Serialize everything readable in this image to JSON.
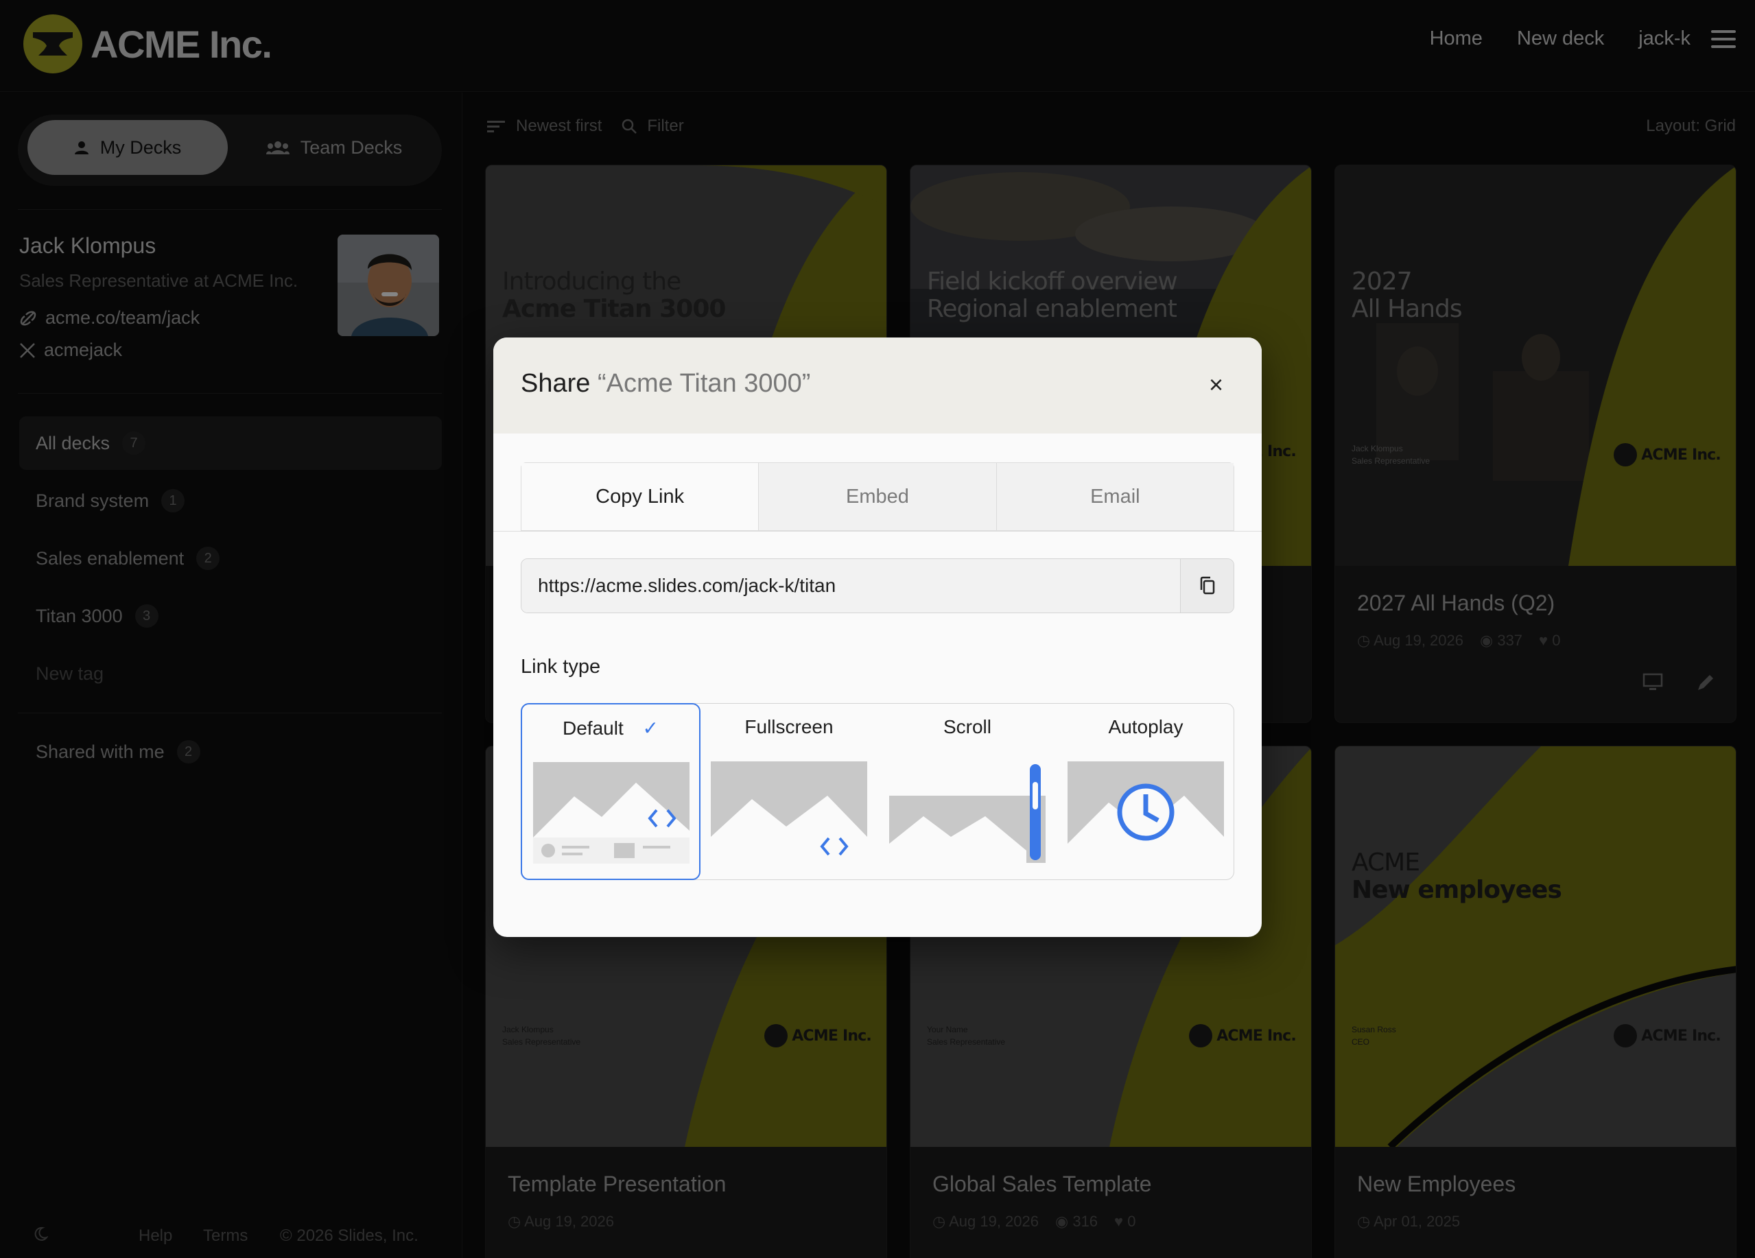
{
  "header": {
    "brand": "ACME Inc.",
    "nav": [
      "Home",
      "New deck",
      "jack-k"
    ]
  },
  "sidebar": {
    "tabs": {
      "my": "My Decks",
      "team": "Team Decks"
    },
    "profile": {
      "name": "Jack Klompus",
      "role": "Sales Representative at ACME Inc.",
      "website": "acme.co/team/jack",
      "x_handle": "acmejack"
    },
    "tags": [
      {
        "label": "All decks",
        "count": "7"
      },
      {
        "label": "Brand system",
        "count": "1"
      },
      {
        "label": "Sales enablement",
        "count": "2"
      },
      {
        "label": "Titan 3000",
        "count": "3"
      }
    ],
    "new_tag": "New tag",
    "shared": {
      "label": "Shared with me",
      "count": "2"
    },
    "footer": {
      "help": "Help",
      "terms": "Terms",
      "copyright": "© 2026 Slides, Inc."
    }
  },
  "toolbar": {
    "sort": "Newest first",
    "filter": "Filter",
    "layout": "Layout: Grid"
  },
  "decks": [
    {
      "slide_line1": "Introducing the",
      "slide_line2": "Acme Titan 3000",
      "title": "",
      "date": "",
      "views": "",
      "likes": ""
    },
    {
      "slide_line1": "Field kickoff overview",
      "slide_line2": "Regional enablement",
      "title": "",
      "date": "",
      "views": "",
      "likes": ""
    },
    {
      "slide_line1": "2027",
      "slide_line2": "All Hands",
      "byline_name": "Jack Klompus",
      "byline_role": "Sales Representative",
      "title": "2027 All Hands (Q2)",
      "date": "Aug 19, 2026",
      "views": "337",
      "likes": "0"
    },
    {
      "byline_name": "Jack Klompus",
      "byline_role": "Sales Representative",
      "title": "Template Presentation",
      "date": "Aug 19, 2026",
      "views": "",
      "likes": ""
    },
    {
      "byline_name": "Your Name",
      "byline_role": "Sales Representative",
      "title": "Global Sales Template",
      "date": "Aug 19, 2026",
      "views": "316",
      "likes": "0"
    },
    {
      "slide_line1": "ACME",
      "slide_line2": "New employees",
      "byline_name": "Susan Ross",
      "byline_role": "CEO",
      "title": "New Employees",
      "date": "Apr 01, 2025",
      "views": "",
      "likes": ""
    }
  ],
  "slide_brand": "ACME Inc.",
  "share_modal": {
    "title": "Share",
    "deck_name": "“Acme Titan 3000”",
    "close": "×",
    "tabs": [
      "Copy Link",
      "Embed",
      "Email"
    ],
    "url": "https://acme.slides.com/jack-k/titan",
    "link_type_label": "Link type",
    "link_types": [
      "Default",
      "Fullscreen",
      "Scroll",
      "Autoplay"
    ],
    "selected_link_type": "Default"
  },
  "colors": {
    "accent_yellow": "#c9c920",
    "selection_blue": "#3b78e7",
    "brand_olive": "#9a9a22"
  }
}
